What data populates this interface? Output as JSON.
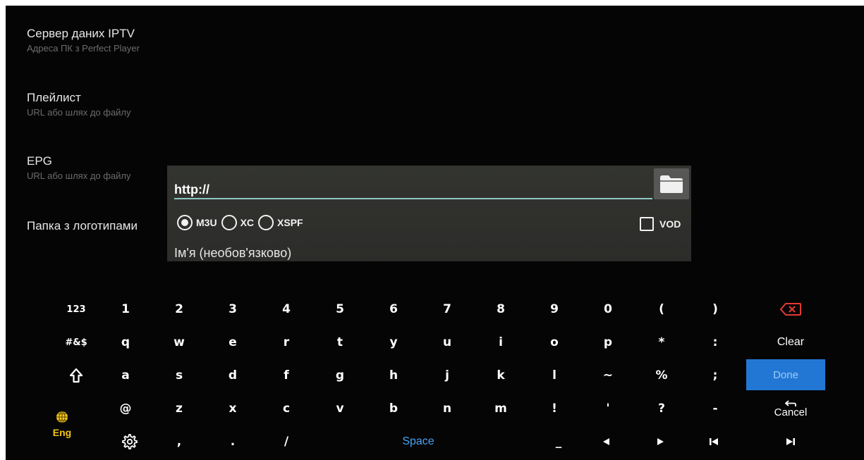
{
  "settings": [
    {
      "title": "Сервер даних IPTV",
      "subtitle": "Адреса ПК з Perfect Player"
    },
    {
      "title": "Плейлист",
      "subtitle": "URL або шлях до файлу"
    },
    {
      "title": "EPG",
      "subtitle": "URL або шлях до файлу"
    },
    {
      "title": "Папка з логотипами",
      "subtitle": ""
    }
  ],
  "dialog": {
    "url_value": "http://",
    "format_options": [
      {
        "label": "M3U",
        "selected": true
      },
      {
        "label": "XC",
        "selected": false
      },
      {
        "label": "XSPF",
        "selected": false
      }
    ],
    "vod_label": "VOD",
    "vod_checked": false,
    "name_placeholder": "Ім'я (необов'язково)"
  },
  "keyboard": {
    "row1": [
      "1",
      "2",
      "3",
      "4",
      "5",
      "6",
      "7",
      "8",
      "9",
      "0",
      "(",
      ")"
    ],
    "row2": [
      "q",
      "w",
      "e",
      "r",
      "t",
      "y",
      "u",
      "i",
      "o",
      "p",
      "*",
      ":"
    ],
    "row3": [
      "a",
      "s",
      "d",
      "f",
      "g",
      "h",
      "j",
      "k",
      "l",
      "~",
      "%",
      ";"
    ],
    "row4": [
      "@",
      "z",
      "x",
      "c",
      "v",
      "b",
      "n",
      "m",
      "!",
      "'",
      "?",
      "-"
    ],
    "row5": [
      ",",
      ".",
      "/"
    ],
    "numbers_mode_label": "123",
    "symbols_mode_label": "#&$",
    "clear_label": "Clear",
    "done_label": "Done",
    "cancel_label": "Cancel",
    "language_label": "Eng",
    "space_label": "Space",
    "underscore_label": "_",
    "icons": {
      "backspace": "backspace-icon",
      "shift": "shift-icon",
      "globe": "globe-icon",
      "settings": "gear-icon",
      "left": "left-arrow-icon",
      "right": "right-arrow-icon",
      "home": "skip-start-icon",
      "end": "skip-end-icon",
      "cancel": "undo-arrow-icon"
    }
  },
  "colors": {
    "done_key": "#2377d4",
    "space_text": "#4aa3f3",
    "language_key": "#f3c31a",
    "backspace_icon": "#e53935",
    "input_underline": "#8fc8c2"
  }
}
